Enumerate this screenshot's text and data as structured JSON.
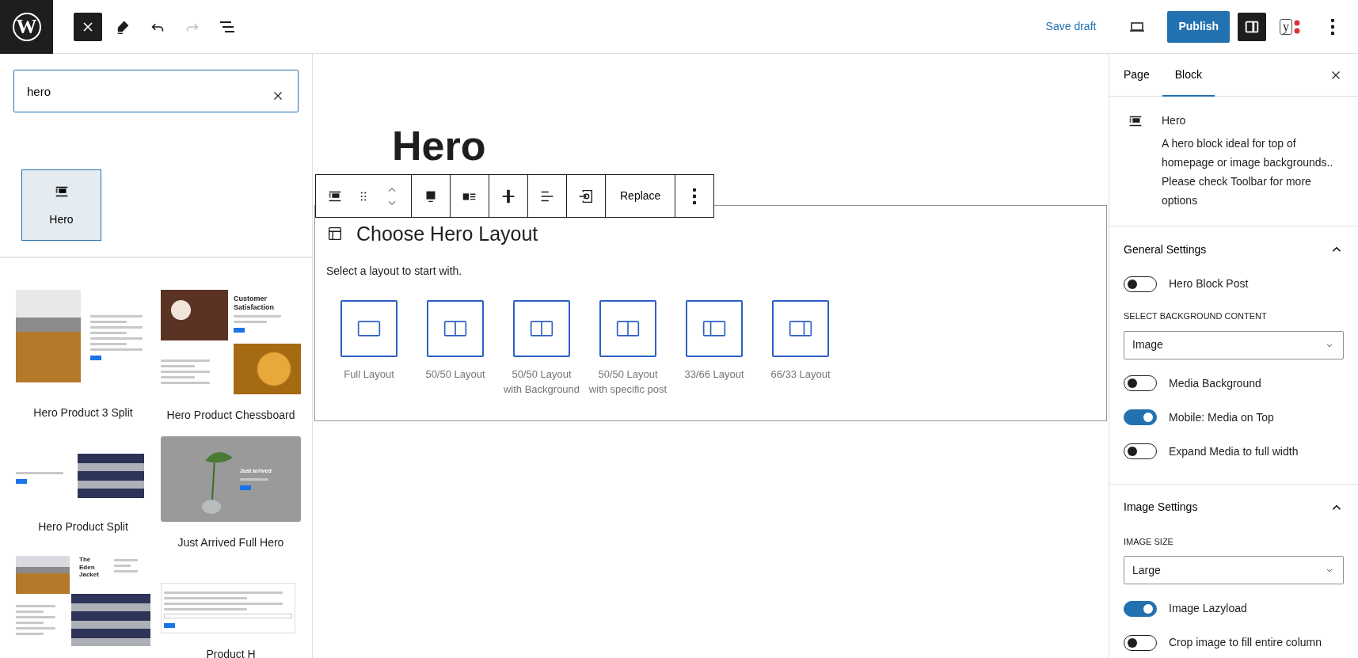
{
  "logo_letter": "W",
  "header_tools": {
    "undo_disabled": false,
    "redo_disabled": true
  },
  "header_actions": {
    "save_draft": "Save draft",
    "publish": "Publish",
    "settings_open": true,
    "plugin_letter": "y"
  },
  "inserter": {
    "search": {
      "value": "hero"
    },
    "blocks": [
      {
        "label": "Hero",
        "selected": true
      }
    ],
    "patterns": [
      {
        "kind": "split3",
        "label": "Hero Product 3 Split"
      },
      {
        "kind": "chessboard",
        "label": "Hero Product Chessboard",
        "preview_heading": "Customer Satisfaction"
      },
      {
        "kind": "split",
        "label": "Hero Product Split"
      },
      {
        "kind": "full",
        "label": "Just Arrived Full Hero",
        "preview_heading": "Just arrived"
      },
      {
        "kind": "jacket",
        "preview_heading": "The Eden Jacket"
      },
      {
        "kind": "form",
        "label": "Product H"
      }
    ]
  },
  "editor": {
    "title": "Hero",
    "toolbar": {
      "replace": "Replace"
    },
    "placeholder": {
      "title": "Choose Hero Layout",
      "instructions": "Select a layout to start with.",
      "layouts": [
        {
          "kind": "full",
          "label": "Full Layout"
        },
        {
          "kind": "half",
          "label": "50/50 Layout"
        },
        {
          "kind": "half",
          "label": "50/50 Layout with Background"
        },
        {
          "kind": "half",
          "label": "50/50 Layout with specific post"
        },
        {
          "kind": "third",
          "label": "33/66 Layout"
        },
        {
          "kind": "twothirds",
          "label": "66/33 Layout"
        }
      ]
    }
  },
  "sidebar": {
    "tabs": [
      {
        "label": "Page",
        "selected": false
      },
      {
        "label": "Block",
        "selected": true
      }
    ],
    "block_card": {
      "title": "Hero",
      "description": "A hero block ideal for top of homepage or image backgrounds.. Please check Toolbar for more options"
    },
    "panels": [
      {
        "title": "General Settings",
        "expanded": true,
        "controls": [
          {
            "kind": "toggle",
            "label": "Hero Block Post",
            "on": false
          },
          {
            "kind": "select",
            "label": "SELECT BACKGROUND CONTENT",
            "value": "Image"
          },
          {
            "kind": "toggle",
            "label": "Media Background",
            "on": false
          },
          {
            "kind": "toggle",
            "label": "Mobile: Media on Top",
            "on": true
          },
          {
            "kind": "toggle",
            "label": "Expand Media to full width",
            "on": false
          }
        ]
      },
      {
        "title": "Image Settings",
        "expanded": true,
        "controls": [
          {
            "kind": "select",
            "label": "IMAGE SIZE",
            "value": "Large"
          },
          {
            "kind": "toggle",
            "label": "Image Lazyload",
            "on": true
          },
          {
            "kind": "toggle",
            "label": "Crop image to fill entire column",
            "on": false
          }
        ]
      }
    ]
  }
}
